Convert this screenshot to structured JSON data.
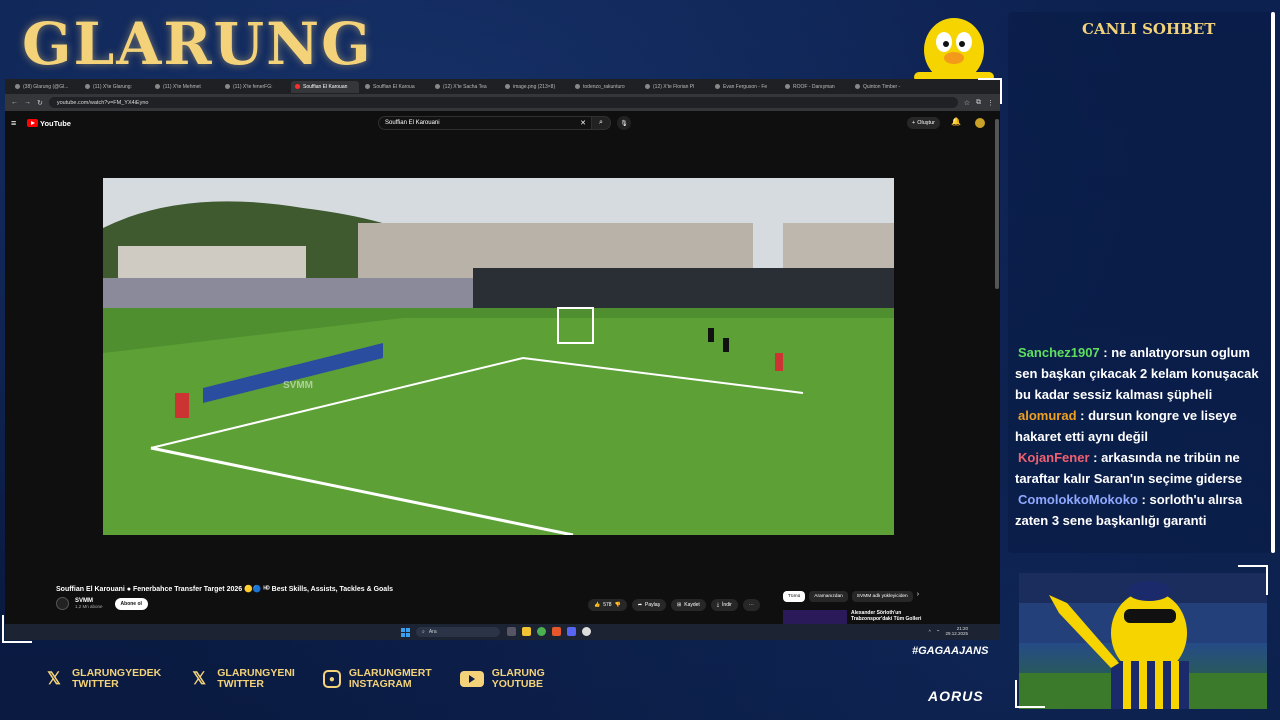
{
  "overlay": {
    "logo": "GLARUNG",
    "hashtag": "#GAGAAJANS",
    "sponsor": "AORUS"
  },
  "browser": {
    "tabs": [
      "(38) Glarung (@Gl...",
      "(11) X'te Glarung:",
      "(11) X'te Mehmet",
      "(11) X'te fenerFG:",
      "Souffian El Karouan",
      "Souffian El Karoua",
      "(12) X'te Sacha Tea",
      "image.png (213×8)",
      "todenzo_rakunturo",
      "(12) X'te Florian Pl",
      "Evan Ferguson - Fe",
      "ROOF - Danışman",
      "Quinton Timber -"
    ],
    "active_tab_index": 4,
    "url": "youtube.com/watch?v=FM_YX4iEyno"
  },
  "youtube": {
    "logo_text": "YouTube",
    "search_value": "Souffian El Karouani",
    "create_label": "Oluştur",
    "video_title": "Souffian El Karouani ● Fenerbahce Transfer Target 2026 🟡🔵 ᴴᴰ Best Skills, Assists, Tackles & Goals",
    "watermark": "SVMM",
    "channel_name": "SVMM",
    "channel_subs": "1,2 Mn abone",
    "subscribe_label": "Abone ol",
    "likes": "578",
    "share_label": "Paylaş",
    "save_label": "Kaydet",
    "download_label": "İndir",
    "chips": [
      "Tümü",
      "Aramanızdan",
      "SVMM adlı yükleyiciden"
    ],
    "suggested_title": "Alexander Sörloth'un Trabzonspor'daki Tüm Golleri"
  },
  "taskbar": {
    "search_placeholder": "Ara",
    "time": "21:20",
    "date": "29.12.2025"
  },
  "chat": {
    "header": "CANLI SOHBET",
    "messages": [
      {
        "user": "Sanchez1907",
        "text": ": ne anlatıyorsun oglum sen başkan çıkacak 2 kelam konuşacak bu kadar sessiz kalması şüpheli",
        "color": "#5ee05e"
      },
      {
        "user": "alomurad",
        "text": ": dursun kongre ve liseye hakaret etti aynı değil",
        "color": "#f0a020"
      },
      {
        "user": "KojanFener",
        "text": ": arkasında ne tribün ne taraftar kalır Saran'ın seçime giderse",
        "color": "#f06070"
      },
      {
        "user": "ComolokkoMokoko",
        "text": ": sorloth'u alırsa zaten 3 sene başkanlığı garanti",
        "color": "#8fa8ff"
      }
    ]
  },
  "socials": [
    {
      "icon": "x-icon",
      "line1": "GLARUNGYEDEK",
      "line2": "TWITTER"
    },
    {
      "icon": "x-icon",
      "line1": "GLARUNGYENI",
      "line2": "TWITTER"
    },
    {
      "icon": "instagram-icon",
      "line1": "GLARUNGMERT",
      "line2": "INSTAGRAM"
    },
    {
      "icon": "youtube-icon",
      "line1": "GLARUNG",
      "line2": "YOUTUBE"
    }
  ],
  "colors": {
    "gold": "#f3d27a",
    "background": "#0c1f45",
    "youtube_red": "#ff0000"
  }
}
